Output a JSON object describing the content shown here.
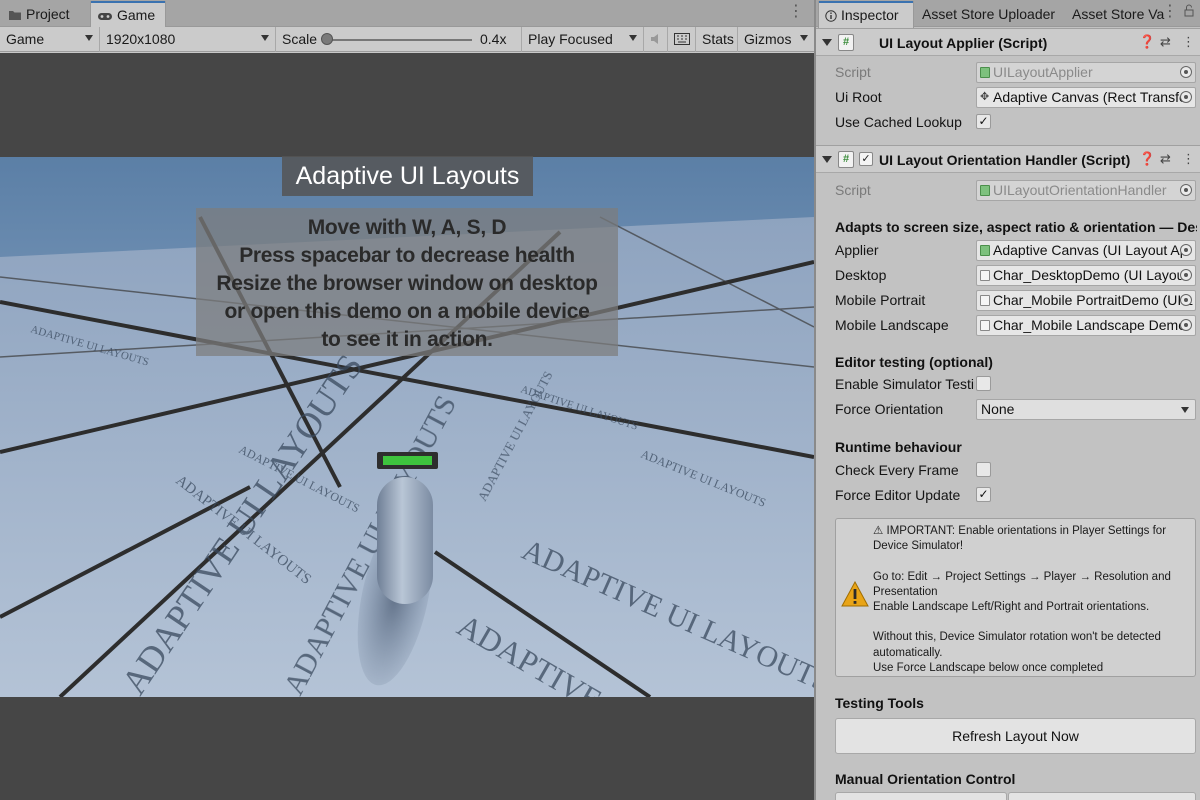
{
  "game_panel": {
    "tabs": [
      {
        "label": "Project",
        "icon": "folder-icon"
      },
      {
        "label": "Game",
        "icon": "gamepad-icon"
      }
    ],
    "toolbar": {
      "display": "Game",
      "resolution": "1920x1080",
      "scale_label": "Scale",
      "scale_value": "0.4x",
      "play_mode": "Play Focused",
      "stats": "Stats",
      "gizmos": "Gizmos"
    }
  },
  "game_view": {
    "title": "Adaptive UI Layouts",
    "instructions": [
      "Move with W, A, S, D",
      "Press spacebar to decrease health",
      "Resize the browser window on desktop",
      "or open this demo on a mobile device",
      "to see it in action."
    ],
    "floor_text": "ADAPTIVE UI LAYOUTS",
    "health_fraction": 1.0,
    "health_color": "#3ec43e"
  },
  "inspector": {
    "tabs": [
      "Inspector",
      "Asset Store Uploader",
      "Asset Store Va"
    ],
    "components": [
      {
        "name": "UI Layout Applier (Script)",
        "fields": [
          {
            "label": "Script",
            "value": "UILayoutApplier",
            "disabled": true
          },
          {
            "label": "Ui Root",
            "value": "Adaptive Canvas (Rect Transfo"
          }
        ],
        "use_cached_lookup_label": "Use Cached Lookup",
        "use_cached_lookup": true
      },
      {
        "name": "UI Layout Orientation Handler (Script)",
        "enabled": true,
        "script_label": "Script",
        "script_value": "UILayoutOrientationHandler",
        "description": "Adapts to screen size, aspect ratio & orientation — Deskto",
        "fields": [
          {
            "label": "Applier",
            "value": "Adaptive Canvas (UI Layout Ap"
          },
          {
            "label": "Desktop",
            "value": "Char_DesktopDemo (UI Layout"
          },
          {
            "label": "Mobile Portrait",
            "value": "Char_Mobile PortraitDemo (UI L"
          },
          {
            "label": "Mobile Landscape",
            "value": "Char_Mobile Landscape Demo"
          }
        ],
        "editor_testing": {
          "header": "Editor testing (optional)",
          "enable_simulator_label": "Enable Simulator Testir",
          "enable_simulator": false,
          "force_orientation_label": "Force Orientation",
          "force_orientation_value": "None"
        },
        "runtime": {
          "header": "Runtime behaviour",
          "check_every_frame_label": "Check Every Frame",
          "check_every_frame": false,
          "force_editor_update_label": "Force Editor Update",
          "force_editor_update": true
        },
        "help_lines": [
          "⚠ IMPORTANT: Enable orientations in Player Settings for",
          "Device Simulator!",
          "",
          "Go to: Edit → Project Settings → Player → Resolution and",
          "Presentation",
          "Enable Landscape Left/Right and Portrait orientations.",
          "",
          "Without this, Device Simulator rotation won't be detected",
          "automatically.",
          "Use Force Landscape below once completed"
        ],
        "testing_tools_header": "Testing Tools",
        "refresh_button": "Refresh Layout Now",
        "manual_header": "Manual Orientation Control"
      }
    ]
  },
  "colors": {
    "accent": "#3a72b0",
    "warning": "#e8a417",
    "script_green": "#3a8c3a"
  }
}
